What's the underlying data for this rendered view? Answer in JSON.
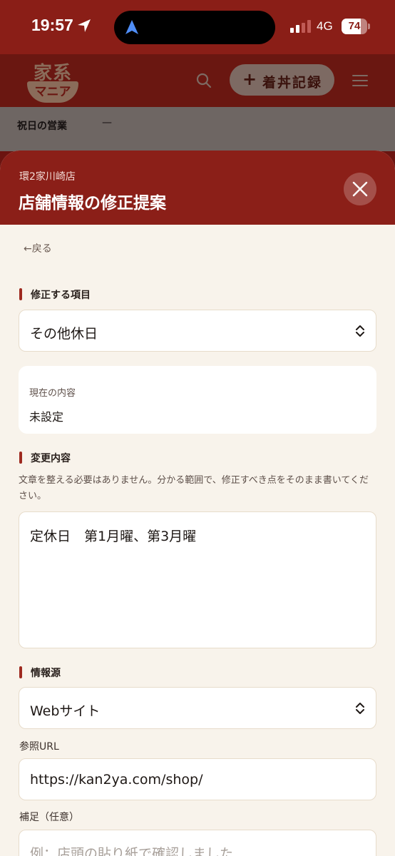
{
  "status_bar": {
    "time": "19:57",
    "network": "4G",
    "battery": "74",
    "battery_level": 0.74,
    "icons": [
      "location-arrow-icon",
      "navigation-icon",
      "cellular-signal-icon",
      "battery-icon"
    ]
  },
  "app_header": {
    "logo_top": "家系",
    "logo_bottom": "マニア",
    "search_icon": "search-icon",
    "record_button_label": "着丼記録",
    "menu_icon": "hamburger-menu-icon"
  },
  "background": {
    "holiday_label": "祝日の営業",
    "holiday_value": "—"
  },
  "modal": {
    "store_name": "環2家川崎店",
    "title": "店舗情報の修正提案",
    "close_icon": "close-icon",
    "back_link": "←戻る",
    "field_item": {
      "label": "修正する項目",
      "value": "その他休日"
    },
    "current": {
      "label": "現在の内容",
      "value": "未設定"
    },
    "change": {
      "label": "変更内容",
      "help": "文章を整える必要はありません。分かる範囲で、修正すべき点をそのまま書いてください。",
      "value": "定休日　第1月曜、第3月曜"
    },
    "source": {
      "label": "情報源",
      "value": "Webサイト"
    },
    "reference_url": {
      "label": "参照URL",
      "value": "https://kan2ya.com/shop/"
    },
    "note": {
      "label": "補足（任意）",
      "placeholder": "例：店頭の貼り紙で確認しました"
    }
  },
  "colors": {
    "brand_red": "#8b1f18",
    "sheet_bg": "#f8f3eb",
    "accent_bar": "#9e2a20"
  }
}
